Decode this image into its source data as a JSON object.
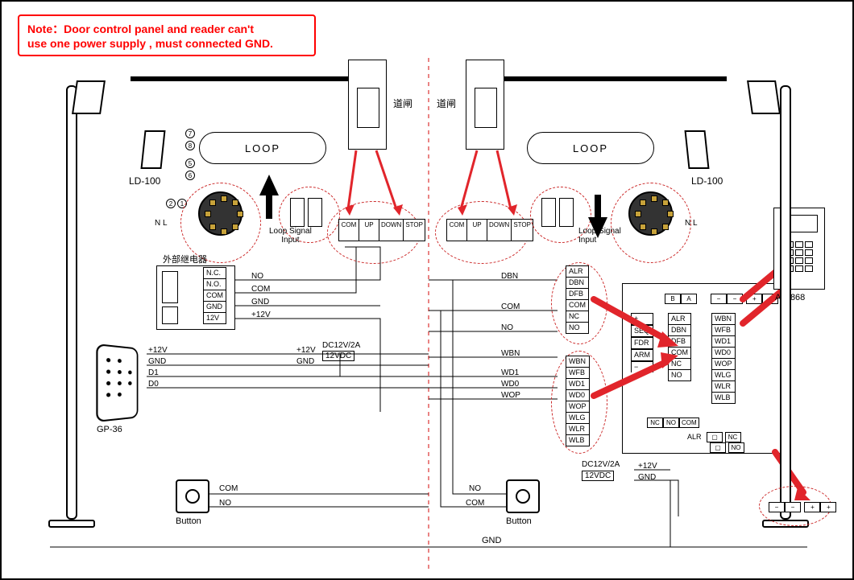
{
  "note": {
    "line1": "Note：Door control panel and  reader can't",
    "line2": "use one power supply , must connected GND."
  },
  "gate_label_cn": "道闸",
  "left": {
    "loop_label": "LOOP",
    "loop_signal": "Loop Signal\nInput",
    "ld100": "LD-100",
    "nl": "N L",
    "reader_model": "GP-36",
    "reader_pins": {
      "p1": "+12V",
      "p2": "GND",
      "p3": "D1",
      "p4": "D0"
    },
    "relay_title": "外部继电器",
    "relay_pins": {
      "nc": "N.C.",
      "no": "N.O.",
      "com": "COM",
      "gnd": "GND",
      "v12": "12V"
    },
    "wire": {
      "no": "NO",
      "com": "COM",
      "gnd": "GND",
      "v12": "+12V"
    },
    "psu": {
      "label1": "DC12V/2A",
      "label2": "12VDC",
      "v12": "+12V",
      "gnd": "GND"
    },
    "btn_label": "Button",
    "btn_wires": {
      "com": "COM",
      "no": "NO"
    },
    "term_labels": [
      "COM",
      "UP",
      "DOWN",
      "STOP"
    ],
    "loop_nums": [
      "1",
      "2",
      "5",
      "6",
      "7",
      "8"
    ]
  },
  "right": {
    "loop_label": "LOOP",
    "loop_signal": "Loop Signal\nInput",
    "ld100": "LD-100",
    "nl": "N L",
    "ac_model": "AC-868",
    "term_labels": [
      "COM",
      "UP",
      "DOWN",
      "STOP"
    ],
    "wire_bus": {
      "dbn": "DBN",
      "com": "COM",
      "no": "NO",
      "wbn": "WBN",
      "wd1": "WD1",
      "wd0": "WD0",
      "wop": "WOP"
    },
    "pinlist1": [
      "ALR",
      "DBN",
      "DFB",
      "COM",
      "NC",
      "NO"
    ],
    "pinlist2": [
      "WBN",
      "WFB",
      "WD1",
      "WD0",
      "WOP",
      "WLG",
      "WLR",
      "WLB"
    ],
    "ctrl_top": {
      "b": "B",
      "a": "A",
      "minus": "−",
      "plus": "+",
      "plus2": "+",
      "minus2": "−"
    },
    "ctrl_left": [
      "+",
      "SEQ",
      "FDR",
      "ARM",
      "−"
    ],
    "ctrl_mid": [
      "ALR",
      "DBN",
      "DFB",
      "COM",
      "NC",
      "NO"
    ],
    "ctrl_right": [
      "WBN",
      "WFB",
      "WD1",
      "WD0",
      "WOP",
      "WLG",
      "WLR",
      "WLB"
    ],
    "ctrl_bottom": [
      "NC",
      "NO",
      "COM"
    ],
    "ctrl_alr_sw": {
      "label": "ALR",
      "nc": "NC",
      "no": "NO"
    },
    "psu": {
      "label1": "DC12V/2A",
      "label2": "12VDC",
      "v12": "+12V",
      "gnd": "GND"
    },
    "btn_label": "Button",
    "btn_wires": {
      "no": "NO",
      "com": "COM"
    },
    "bottom_terms": [
      "−",
      "−",
      "+",
      "+"
    ]
  },
  "shared": {
    "gnd_bus": "GND"
  }
}
